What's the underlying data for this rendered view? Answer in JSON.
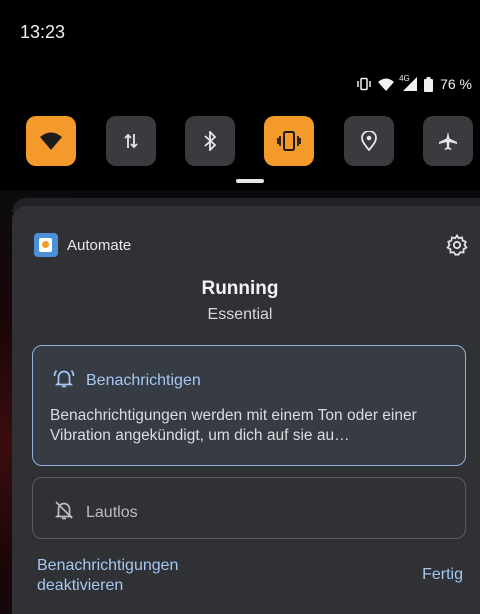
{
  "status_bar": {
    "time": "13:23",
    "battery": "76 %",
    "network_type": "4G",
    "icons": [
      "vibrate-icon",
      "wifi-icon",
      "signal-icon",
      "battery-icon"
    ]
  },
  "quick_settings": [
    {
      "name": "wifi",
      "icon": "wifi-icon",
      "active": true
    },
    {
      "name": "mobile-data",
      "icon": "data-arrows-icon",
      "active": false
    },
    {
      "name": "bluetooth",
      "icon": "bluetooth-icon",
      "active": false
    },
    {
      "name": "vibrate",
      "icon": "vibrate-icon",
      "active": true
    },
    {
      "name": "location",
      "icon": "location-icon",
      "active": false
    },
    {
      "name": "airplane",
      "icon": "airplane-icon",
      "active": false
    }
  ],
  "notification": {
    "app_name": "Automate",
    "title": "Running",
    "subtitle": "Essential",
    "options": {
      "notify": {
        "label": "Benachrichtigen",
        "description": "Benachrichtigungen werden mit einem Ton oder einer Vibration angekündigt, um dich auf sie au…",
        "selected": true
      },
      "silent": {
        "label": "Lautlos",
        "selected": false
      }
    },
    "disable_label_line1": "Benachrichtigungen",
    "disable_label_line2": "deaktivieren",
    "done_label": "Fertig"
  },
  "colors": {
    "accent_orange": "#f49a2b",
    "link_blue": "#a6c8f2",
    "panel": "#2f3135"
  }
}
